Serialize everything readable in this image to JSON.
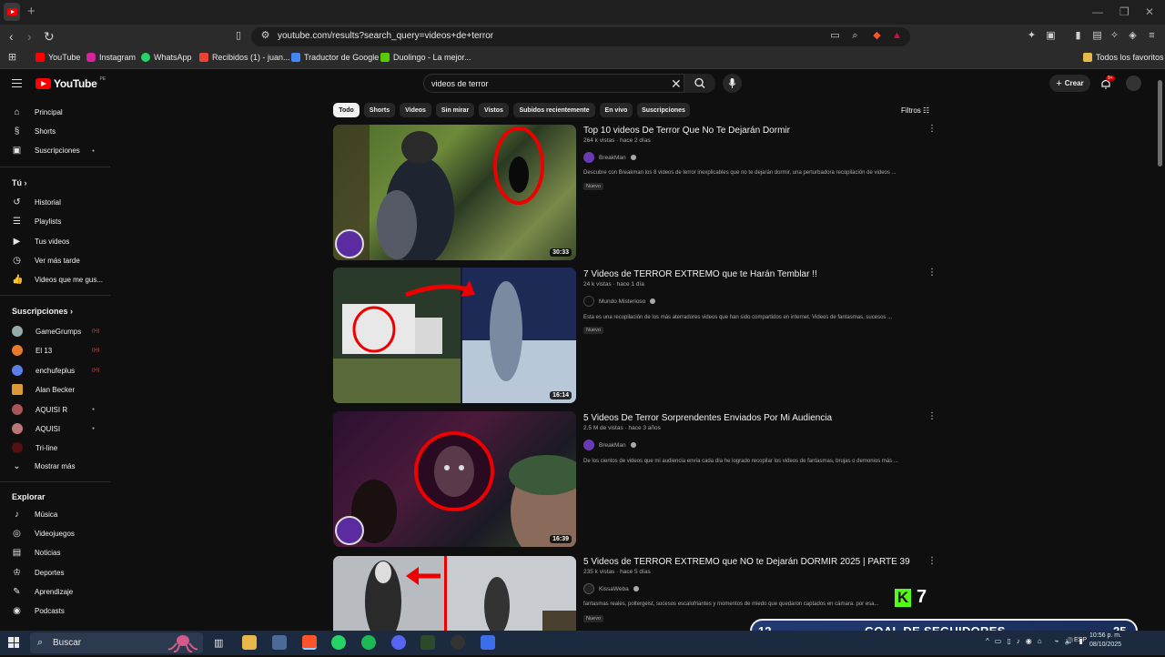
{
  "browser": {
    "url": "youtube.com/results?search_query=videos+de+terror",
    "bookmarks": [
      "YouTube",
      "Instagram",
      "WhatsApp",
      "Recibidos (1) - juan...",
      "Traductor de Google",
      "Duolingo - La mejor...",
      "Todos los favoritos"
    ]
  },
  "header": {
    "logo": "YouTube",
    "logo_country": "PE",
    "search_value": "videos de terror",
    "create_label": "Crear",
    "notification_badge": "9+"
  },
  "sidebar": {
    "main": [
      "Principal",
      "Shorts",
      "Suscripciones"
    ],
    "you_header": "Tú",
    "you_items": [
      "Historial",
      "Playlists",
      "Tus videos",
      "Ver más tarde",
      "Videos que me gus..."
    ],
    "subs_header": "Suscripciones",
    "subs": [
      "GameGrumps",
      "El 13",
      "enchufeplus",
      "Alan Becker",
      "AQUISI R",
      "AQUISI",
      "Tri-line"
    ],
    "show_more": "Mostrar más",
    "explore_header": "Explorar",
    "explore_items": [
      "Música",
      "Videojuegos",
      "Noticias",
      "Deportes",
      "Aprendizaje",
      "Podcasts"
    ]
  },
  "chips": [
    "Todo",
    "Shorts",
    "Videos",
    "Sin mirar",
    "Vistos",
    "Subidos recientemente",
    "En vivo",
    "Suscripciones"
  ],
  "filters_label": "Filtros",
  "videos": [
    {
      "title": "Top 10 videos De Terror Que No Te Dejarán Dormir",
      "meta": "264 k vistas · hace 2 días",
      "channel": "BreakMan",
      "desc": "Descubre con Breakman los 8 videos de terror inexplicables que no te dejarán dormir, una perturbadora recopilación de videos ...",
      "badge": "Nuevo",
      "duration": "30:33"
    },
    {
      "title": "7 Videos de TERROR EXTREMO que te Harán Temblar !!",
      "meta": "24 k vistas · hace 1 día",
      "channel": "Mundo Misterioso",
      "desc": "Esta es una recopilación de los más aterradores videos que han sido compartidos en internet. Videos de fantasmas, sucesos ...",
      "badge": "Nuevo",
      "duration": "16:14"
    },
    {
      "title": "5 Videos De Terror Sorprendentes Enviados Por Mi Audiencia",
      "meta": "2.5 M de vistas · hace 3 años",
      "channel": "BreakMan",
      "desc": "De los cientos de videos que mi audiencia envía cada día he logrado recopilar los videos de fantasmas, brujas o demonios más ...",
      "badge": "",
      "duration": "16:39"
    },
    {
      "title": "5 Videos de TERROR EXTREMO que NO te Dejarán DORMIR 2025 | PARTE 39",
      "meta": "235 k vistas · hace 5 días",
      "channel": "KissaWeba",
      "desc": "fantasmas reales, poltergeist, sucesos escalofriantes y momentos de miedo que quedaron captados en cámara. por esa...",
      "badge": "Nuevo",
      "duration": ""
    }
  ],
  "overlay": {
    "k_logo": "K",
    "k_count": "7",
    "goal_left": "12",
    "goal_label": "GOAL DE SEGUIDORES",
    "goal_right": "25"
  },
  "taskbar": {
    "search": "Buscar",
    "lang": "ESP",
    "time": "10:56 p. m.",
    "date": "08/10/2025"
  }
}
